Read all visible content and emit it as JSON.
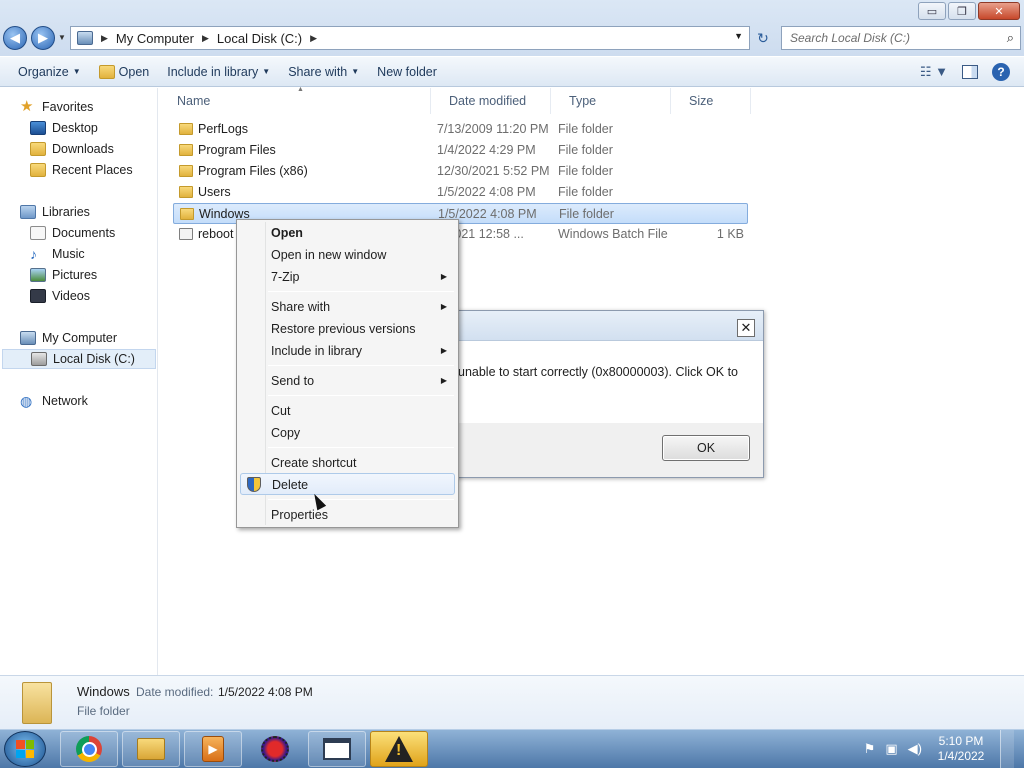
{
  "window": {
    "minimize": "▭",
    "maximize": "❐",
    "close": "✕"
  },
  "nav": {
    "back": "◀",
    "forward": "▶",
    "dropdown": "▼"
  },
  "address": {
    "crumbs": [
      "My Computer",
      "Local Disk (C:)"
    ],
    "sep": "▶",
    "dropdown": "▼"
  },
  "refresh": "↻",
  "search": {
    "placeholder": "Search Local Disk (C:)",
    "icon": "⌕"
  },
  "toolbar": {
    "organize": "Organize",
    "open": "Open",
    "include": "Include in library",
    "share": "Share with",
    "new_folder": "New folder",
    "caret": "▼",
    "view_icon": "☷ ▼",
    "help": "?"
  },
  "sidebar": {
    "favorites": "Favorites",
    "desktop": "Desktop",
    "downloads": "Downloads",
    "recent": "Recent Places",
    "libraries": "Libraries",
    "documents": "Documents",
    "music": "Music",
    "pictures": "Pictures",
    "videos": "Videos",
    "computer": "My Computer",
    "local_disk": "Local Disk (C:)",
    "network": "Network",
    "icons": {
      "star": "★",
      "note": "♪",
      "globe": "◍"
    }
  },
  "columns": {
    "name": "Name",
    "date": "Date modified",
    "type": "Type",
    "size": "Size",
    "sort": "▲"
  },
  "files": [
    {
      "name": "PerfLogs",
      "date": "7/13/2009 11:20 PM",
      "type": "File folder",
      "size": ""
    },
    {
      "name": "Program Files",
      "date": "1/4/2022 4:29 PM",
      "type": "File folder",
      "size": ""
    },
    {
      "name": "Program Files (x86)",
      "date": "12/30/2021 5:52 PM",
      "type": "File folder",
      "size": ""
    },
    {
      "name": "Users",
      "date": "1/5/2022 4:08 PM",
      "type": "File folder",
      "size": ""
    },
    {
      "name": "Windows",
      "date": "1/5/2022 4:08 PM",
      "type": "File folder",
      "size": ""
    },
    {
      "name": "reboot",
      "date": "3/2021 12:58 ...",
      "type": "Windows Batch File",
      "size": "1 KB"
    }
  ],
  "dialog": {
    "close": "✕",
    "message": "unable to start correctly (0x80000003). Click OK to",
    "ok": "OK"
  },
  "context_menu": {
    "open": "Open",
    "open_new": "Open in new window",
    "zip": "7-Zip",
    "share": "Share with",
    "restore": "Restore previous versions",
    "include": "Include in library",
    "send_to": "Send to",
    "cut": "Cut",
    "copy": "Copy",
    "shortcut": "Create shortcut",
    "delete": "Delete",
    "properties": "Properties",
    "sub_arrow": "▶"
  },
  "details": {
    "name": "Windows",
    "date_label": "Date modified:",
    "date": "1/5/2022 4:08 PM",
    "type": "File folder"
  },
  "taskbar": {
    "media_glyph": "▶",
    "tray_icons": [
      "⚑",
      "▣",
      "◀)"
    ],
    "time": "5:10 PM",
    "date": "1/4/2022"
  }
}
